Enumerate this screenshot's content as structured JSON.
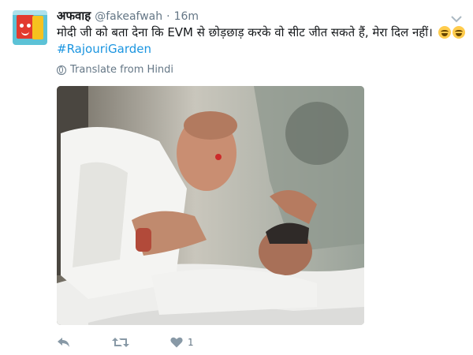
{
  "tweet": {
    "display_name": "अफवाह",
    "handle": "@fakeafwah",
    "separator": "·",
    "time": "16m",
    "text": "मोदी जी को बता देना कि EVM से छोड़छाड़ करके वो सीट जीत सकते हैं, मेरा दिल नहीं।",
    "emoji": [
      "face-with-tears-of-joy-icon",
      "face-with-tears-of-joy-icon"
    ],
    "hashtag": "#RajouriGarden",
    "translate_label": "Translate from Hindi",
    "like_count": "1"
  },
  "colors": {
    "link": "#1b95e0",
    "secondary_text": "#657786",
    "primary_text": "#14171a"
  },
  "icons": {
    "reply": "reply-icon",
    "retweet": "retweet-icon",
    "like": "heart-icon",
    "more": "chevron-down-icon",
    "translate": "globe-icon"
  }
}
